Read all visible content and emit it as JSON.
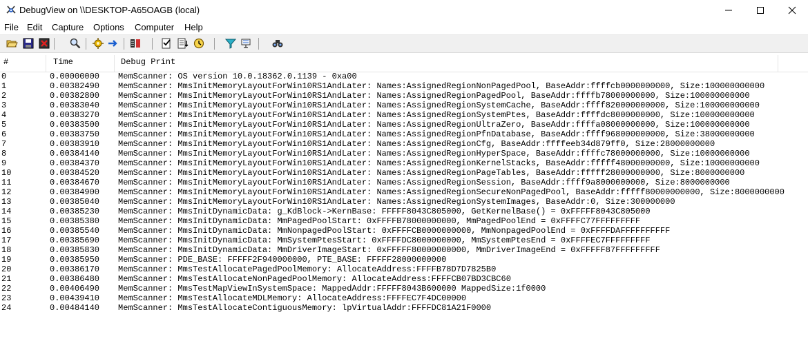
{
  "window": {
    "title": "DebugView on \\\\DESKTOP-A65OAGB (local)"
  },
  "menu": [
    "File",
    "Edit",
    "Capture",
    "Options",
    "Computer",
    "Help"
  ],
  "toolbar": {
    "icons": [
      "open-icon",
      "save-icon",
      "clear-icon",
      "find-icon",
      "capture-icon",
      "autoscroll-icon",
      "capture-kernel-icon",
      "filter-icon",
      "history-depth-icon",
      "time-icon",
      "highlight-icon",
      "event-filter-icon",
      "connect-icon"
    ]
  },
  "columns": {
    "num": "#",
    "time": "Time",
    "print": "Debug Print"
  },
  "rows": [
    {
      "num": "0",
      "time": "0.00000000",
      "print": "MemScanner: OS version 10.0.18362.0.1139 - 0xa00"
    },
    {
      "num": "1",
      "time": "0.00382490",
      "print": "MemScanner: MmsInitMemoryLayoutForWin10RS1AndLater: Names:AssignedRegionNonPagedPool, BaseAddr:ffffcb0000000000, Size:100000000000"
    },
    {
      "num": "2",
      "time": "0.00382800",
      "print": "MemScanner: MmsInitMemoryLayoutForWin10RS1AndLater: Names:AssignedRegionPagedPool, BaseAddr:ffffb78000000000, Size:100000000000"
    },
    {
      "num": "3",
      "time": "0.00383040",
      "print": "MemScanner: MmsInitMemoryLayoutForWin10RS1AndLater: Names:AssignedRegionSystemCache, BaseAddr:ffff820000000000, Size:100000000000"
    },
    {
      "num": "4",
      "time": "0.00383270",
      "print": "MemScanner: MmsInitMemoryLayoutForWin10RS1AndLater: Names:AssignedRegionSystemPtes, BaseAddr:ffffdc8000000000, Size:100000000000"
    },
    {
      "num": "5",
      "time": "0.00383500",
      "print": "MemScanner: MmsInitMemoryLayoutForWin10RS1AndLater: Names:AssignedRegionUltraZero, BaseAddr:ffffa08000000000, Size:100000000000"
    },
    {
      "num": "6",
      "time": "0.00383750",
      "print": "MemScanner: MmsInitMemoryLayoutForWin10RS1AndLater: Names:AssignedRegionPfnDatabase, BaseAddr:ffff968000000000, Size:38000000000"
    },
    {
      "num": "7",
      "time": "0.00383910",
      "print": "MemScanner: MmsInitMemoryLayoutForWin10RS1AndLater: Names:AssignedRegionCfg, BaseAddr:ffffeeb34d879ff0, Size:28000000000"
    },
    {
      "num": "8",
      "time": "0.00384140",
      "print": "MemScanner: MmsInitMemoryLayoutForWin10RS1AndLater: Names:AssignedRegionHyperSpace, BaseAddr:ffffc78000000000, Size:10000000000"
    },
    {
      "num": "9",
      "time": "0.00384370",
      "print": "MemScanner: MmsInitMemoryLayoutForWin10RS1AndLater: Names:AssignedRegionKernelStacks, BaseAddr:fffff48000000000, Size:10000000000"
    },
    {
      "num": "10",
      "time": "0.00384520",
      "print": "MemScanner: MmsInitMemoryLayoutForWin10RS1AndLater: Names:AssignedRegionPageTables, BaseAddr:fffff28000000000, Size:8000000000"
    },
    {
      "num": "11",
      "time": "0.00384670",
      "print": "MemScanner: MmsInitMemoryLayoutForWin10RS1AndLater: Names:AssignedRegionSession, BaseAddr:ffff9a8000000000, Size:8000000000"
    },
    {
      "num": "12",
      "time": "0.00384900",
      "print": "MemScanner: MmsInitMemoryLayoutForWin10RS1AndLater: Names:AssignedRegionSecureNonPagedPool, BaseAddr:fffff80000000000, Size:8000000000"
    },
    {
      "num": "13",
      "time": "0.00385040",
      "print": "MemScanner: MmsInitMemoryLayoutForWin10RS1AndLater: Names:AssignedRegionSystemImages, BaseAddr:0, Size:300000000"
    },
    {
      "num": "14",
      "time": "0.00385230",
      "print": "MemScanner: MmsInitDynamicData: g_KdBlock->KernBase: FFFFF8043C805000, GetKernelBase() = 0xFFFFF8043C805000"
    },
    {
      "num": "15",
      "time": "0.00385380",
      "print": "MemScanner: MmsInitDynamicData: MmPagedPoolStart: 0xFFFFB78000000000, MmPagedPoolEnd = 0xFFFFC77FFFFFFFFF"
    },
    {
      "num": "16",
      "time": "0.00385540",
      "print": "MemScanner: MmsInitDynamicData: MmNonpagedPoolStart: 0xFFFFCB0000000000, MmNonpagedPoolEnd = 0xFFFFDAFFFFFFFFFF"
    },
    {
      "num": "17",
      "time": "0.00385690",
      "print": "MemScanner: MmsInitDynamicData: MmSystemPtesStart: 0xFFFFDC8000000000, MmSystemPtesEnd = 0xFFFFEC7FFFFFFFFF"
    },
    {
      "num": "18",
      "time": "0.00385830",
      "print": "MemScanner: MmsInitDynamicData: MmDriverImageStart: 0xFFFFF80000000000, MmDriverImageEnd = 0xFFFFF87FFFFFFFFF"
    },
    {
      "num": "19",
      "time": "0.00385950",
      "print": "MemScanner: PDE_BASE: FFFFF2F940000000, PTE_BASE: FFFFF28000000000"
    },
    {
      "num": "20",
      "time": "0.00386170",
      "print": "MemScanner: MmsTestAllocatePagedPoolMemory: AllocateAddress:FFFFB78D7D7825B0"
    },
    {
      "num": "21",
      "time": "0.00386480",
      "print": "MemScanner: MmsTestAllocateNonPagedPoolMemory: AllocateAddress:FFFFCB07BD3CBC60"
    },
    {
      "num": "22",
      "time": "0.00406490",
      "print": "MemScanner: MmsTestMapViewInSystemSpace: MappedAddr:FFFFF8043B600000 MappedSize:1f0000"
    },
    {
      "num": "23",
      "time": "0.00439410",
      "print": "MemScanner: MmsTestAllocateMDLMemory: AllocateAddress:FFFFEC7F4DC00000"
    },
    {
      "num": "24",
      "time": "0.00484140",
      "print": "MemScanner: MmsTestAllocateContiguousMemory: lpVirtualAddr:FFFFDC81A21F0000"
    }
  ]
}
